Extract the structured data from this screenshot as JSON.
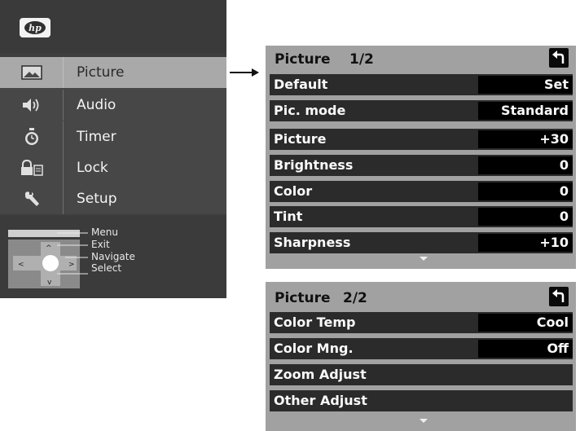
{
  "left_menu": {
    "items": [
      {
        "label": "Picture",
        "icon": "picture-icon",
        "selected": true
      },
      {
        "label": "Audio",
        "icon": "speaker-icon",
        "selected": false
      },
      {
        "label": "Timer",
        "icon": "stopwatch-icon",
        "selected": false
      },
      {
        "label": "Lock",
        "icon": "lock-icon",
        "selected": false
      },
      {
        "label": "Setup",
        "icon": "wrench-icon",
        "selected": false
      }
    ],
    "legend": {
      "menu": "Menu",
      "exit": "Exit",
      "navigate": "Navigate",
      "select": "Select"
    }
  },
  "panel1": {
    "title": "Picture",
    "page": "1/2",
    "rows": [
      {
        "label": "Default",
        "value": "Set"
      },
      {
        "label": "Pic. mode",
        "value": "Standard"
      },
      {
        "label": "Picture",
        "value": "+30"
      },
      {
        "label": "Brightness",
        "value": "0"
      },
      {
        "label": "Color",
        "value": "0"
      },
      {
        "label": "Tint",
        "value": "0"
      },
      {
        "label": "Sharpness",
        "value": "+10"
      }
    ]
  },
  "panel2": {
    "title": "Picture",
    "page": "2/2",
    "rows": [
      {
        "label": "Color Temp",
        "value": "Cool"
      },
      {
        "label": "Color Mng.",
        "value": "Off"
      },
      {
        "label": "Zoom Adjust",
        "value": ""
      },
      {
        "label": "Other Adjust",
        "value": ""
      }
    ]
  },
  "colors": {
    "menu_bg": "#474747",
    "selected_bg": "#a9a9a9",
    "panel_bg": "#a1a1a1",
    "row_bg": "#2b2b2b",
    "value_bg": "#000000"
  }
}
